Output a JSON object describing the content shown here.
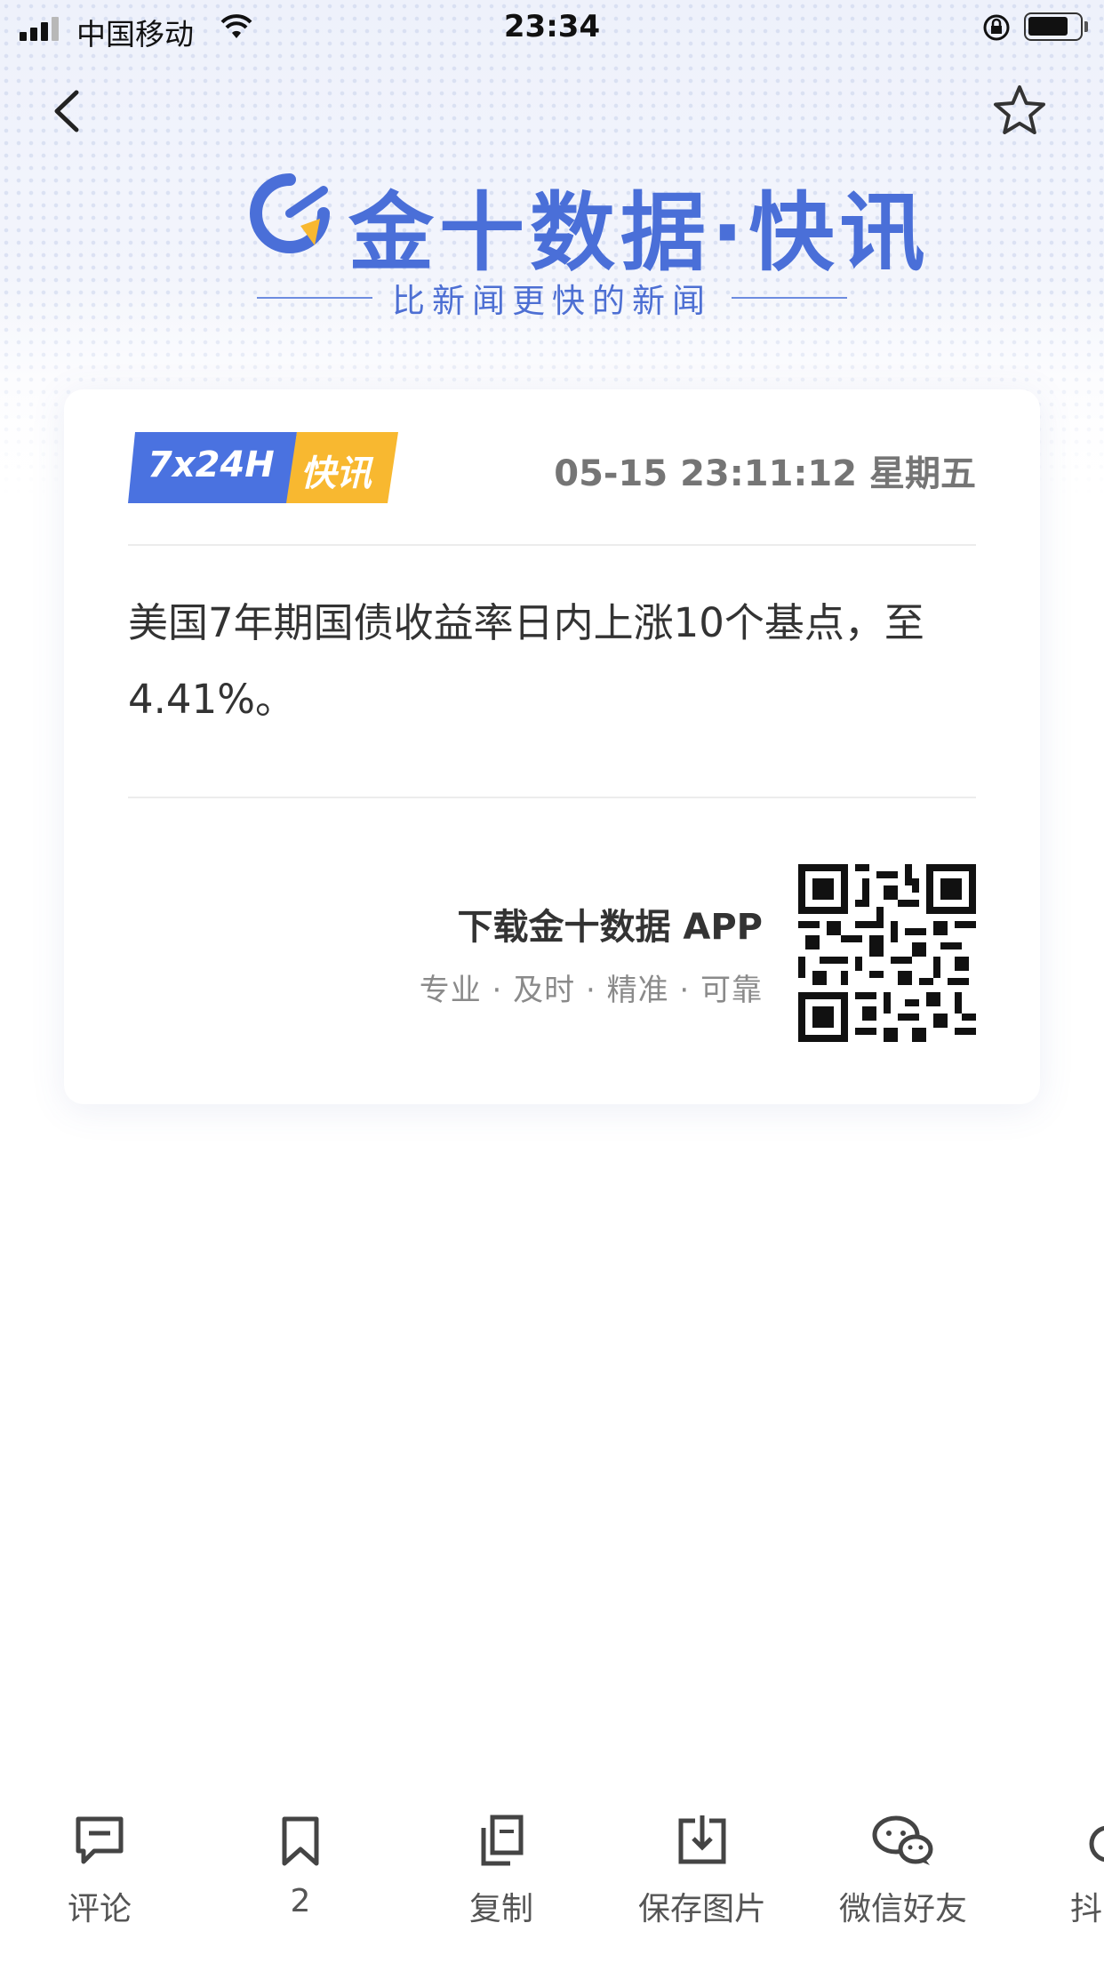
{
  "status_bar": {
    "carrier": "中国移动",
    "time": "23:34"
  },
  "brand": {
    "title": "金十数据·快讯",
    "slogan": "比新闻更快的新闻"
  },
  "card": {
    "badge_en": "7x24H",
    "badge_cn": "快讯",
    "timestamp": "05-15 23:11:12 星期五",
    "body": "美国7年期国债收益率日内上涨10个基点，至4.41%。",
    "download_title": "下载金十数据 APP",
    "download_sub": "专业 · 及时 · 精准 · 可靠"
  },
  "toolbar": {
    "comment": "评论",
    "bookmark_count": "2",
    "copy": "复制",
    "save_image": "保存图片",
    "wechat": "微信好友",
    "douyin": "抖"
  },
  "colors": {
    "brand_blue": "#4a6fd8",
    "badge_yellow": "#f8b830"
  },
  "icons": [
    "signal-icon",
    "wifi-icon",
    "rotation-lock-icon",
    "battery-icon",
    "back-arrow-icon",
    "star-icon",
    "brand-logo-icon",
    "qr-code-icon",
    "comment-icon",
    "bookmark-icon",
    "copy-icon",
    "download-icon",
    "wechat-icon"
  ]
}
